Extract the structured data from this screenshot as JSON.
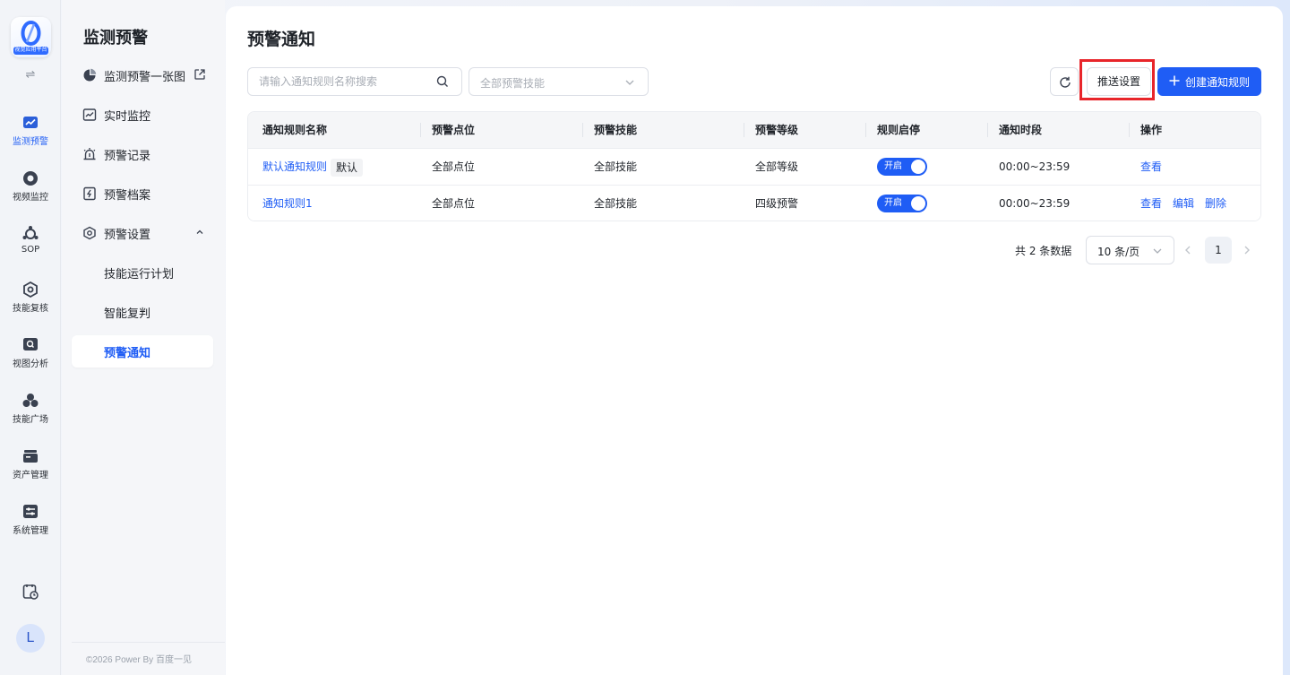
{
  "app": {
    "logo_text": "视觉应用平台",
    "collapse_icon": "collapse-toggle-icon"
  },
  "rail": {
    "items": [
      {
        "label": "监测预警",
        "icon": "monitor-chart-icon",
        "active": true
      },
      {
        "label": "视频监控",
        "icon": "camera-icon",
        "active": false
      },
      {
        "label": "SOP",
        "icon": "sop-icon",
        "active": false
      },
      {
        "label": "技能复核",
        "icon": "hexagon-review-icon",
        "active": false
      },
      {
        "label": "视图分析",
        "icon": "view-analysis-icon",
        "active": false
      },
      {
        "label": "技能广场",
        "icon": "skill-plaza-icon",
        "active": false
      },
      {
        "label": "资产管理",
        "icon": "asset-icon",
        "active": false
      },
      {
        "label": "系统管理",
        "icon": "system-settings-icon",
        "active": false
      }
    ],
    "bottom_icon": "schedule-icon",
    "avatar_letter": "L"
  },
  "sidebar": {
    "title": "监测预警",
    "items": [
      {
        "label": "监测预警一张图",
        "icon": "pie-chart-icon",
        "trail": "external-link-icon"
      },
      {
        "label": "实时监控",
        "icon": "trend-chart-icon"
      },
      {
        "label": "预警记录",
        "icon": "alarm-record-icon"
      },
      {
        "label": "预警档案",
        "icon": "archive-bolt-icon"
      },
      {
        "label": "预警设置",
        "icon": "settings-hex-icon",
        "trail": "chevron-up-icon",
        "expanded": true
      }
    ],
    "sub_items": [
      {
        "label": "技能运行计划",
        "active": false
      },
      {
        "label": "智能复判",
        "active": false
      },
      {
        "label": "预警通知",
        "active": true
      }
    ],
    "copyright": "©2026 Power By 百度一见"
  },
  "main": {
    "title": "预警通知",
    "search": {
      "placeholder": "请输入通知规则名称搜索",
      "value": ""
    },
    "skill_filter": {
      "placeholder": "全部预警技能"
    },
    "push_settings_label": "推送设置",
    "create_label": "创建通知规则",
    "colors": {
      "accent": "#1f5df5",
      "highlight": "#e8252a"
    }
  },
  "table": {
    "columns": [
      "通知规则名称",
      "预警点位",
      "预警技能",
      "预警等级",
      "规则启停",
      "通知时段",
      "操作"
    ],
    "rows": [
      {
        "name": "默认通知规则",
        "tag": "默认",
        "points": "全部点位",
        "skills": "全部技能",
        "level": "全部等级",
        "switch_label": "开启",
        "enabled": true,
        "period": "00:00~23:59",
        "actions": [
          "查看"
        ]
      },
      {
        "name": "通知规则1",
        "tag": "",
        "points": "全部点位",
        "skills": "全部技能",
        "level": "四级预警",
        "switch_label": "开启",
        "enabled": true,
        "period": "00:00~23:59",
        "actions": [
          "查看",
          "编辑",
          "删除"
        ]
      }
    ]
  },
  "pagination": {
    "total_text": "共 2 条数据",
    "page_size": "10 条/页",
    "current_page": "1"
  }
}
